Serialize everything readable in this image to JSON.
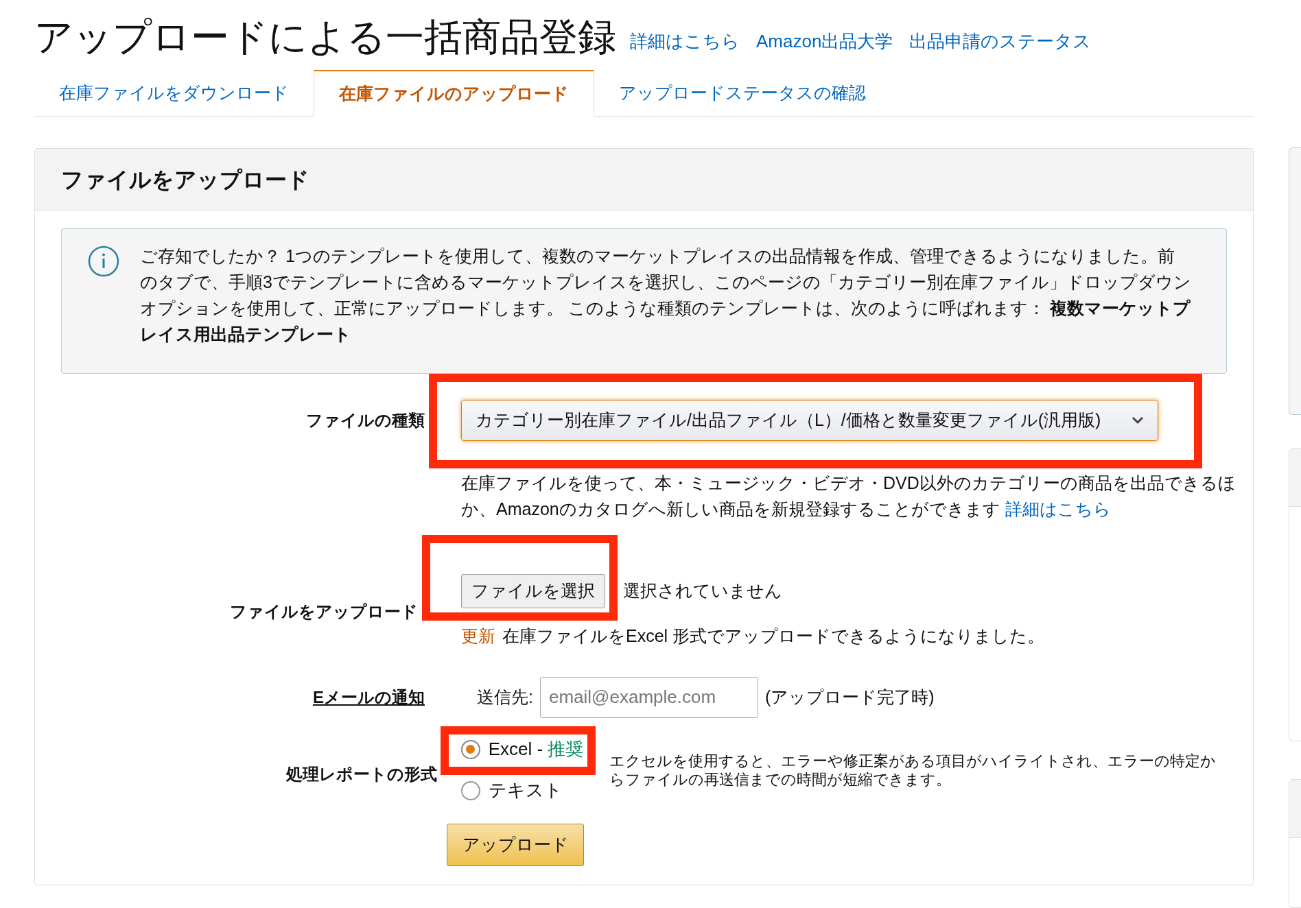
{
  "header": {
    "title": "アップロードによる一括商品登録",
    "links": [
      "詳細はこちら",
      "Amazon出品大学",
      "出品申請のステータス"
    ]
  },
  "tabs": [
    {
      "label": "在庫ファイルをダウンロード",
      "selected": false
    },
    {
      "label": "在庫ファイルのアップロード",
      "selected": true
    },
    {
      "label": "アップロードステータスの確認",
      "selected": false
    }
  ],
  "panel": {
    "title": "ファイルをアップロード",
    "info": "ご存知でしたか？ 1つのテンプレートを使用して、複数のマーケットプレイスの出品情報を作成、管理できるようになりました。前のタブで、手順3でテンプレートに含めるマーケットプレイスを選択し、このページの「カテゴリー別在庫ファイル」ドロップダウンオプションを使用して、正常にアップロードします。 このような種類のテンプレートは、次のように呼ばれます： **複数マーケットプレイス用出品テンプレート**",
    "file_type": {
      "label": "ファイルの種類",
      "value": "カテゴリー別在庫ファイル/出品ファイル（L）/価格と数量変更ファイル(汎用版)",
      "description": "在庫ファイルを使って、本・ミュージック・ビデオ・DVD以外のカテゴリーの商品を出品できるほか、Amazonのカタログへ新しい商品を新規登録することができます",
      "link": "詳細はこちら"
    },
    "upload": {
      "label": "ファイルをアップロード",
      "button": "ファイルを選択",
      "status": "選択されていません",
      "badge": "更新",
      "note": "在庫ファイルをExcel 形式でアップロードできるようになりました。"
    },
    "email": {
      "label": "Eメールの通知",
      "prefix": "送信先:",
      "placeholder": "email@example.com",
      "suffix": "(アップロード完了時)"
    },
    "report": {
      "label": "処理レポートの形式",
      "options": [
        {
          "label": "Excel - ",
          "tag": "推奨",
          "selected": true
        },
        {
          "label": "テキスト",
          "selected": false
        }
      ],
      "hint": "エクセルを使用すると、エラーや修正案がある項目がハイライトされ、エラーの特定からファイルの再送信までの時間が短縮できます。"
    },
    "submit": "アップロード"
  }
}
